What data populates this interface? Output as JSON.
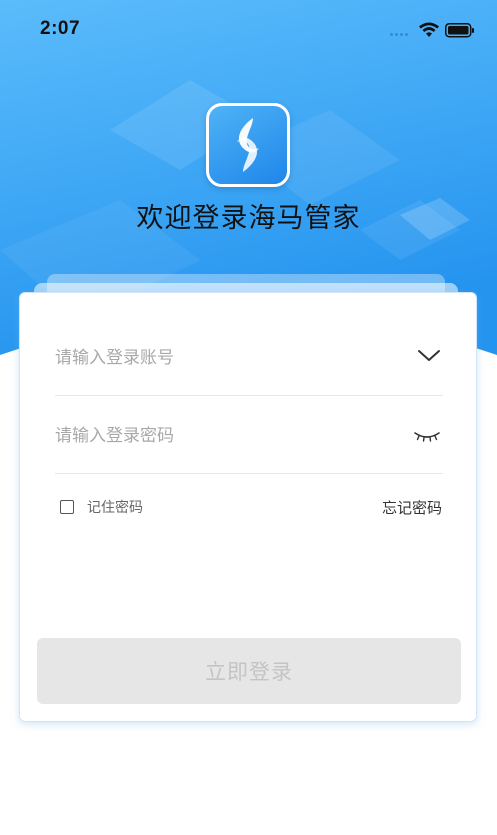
{
  "status_bar": {
    "time": "2:07"
  },
  "header": {
    "welcome_title": "欢迎登录海马管家"
  },
  "login_form": {
    "account_placeholder": "请输入登录账号",
    "password_placeholder": "请输入登录密码",
    "remember_label": "记住密码",
    "remember_checked": false,
    "forgot_label": "忘记密码",
    "submit_label": "立即登录"
  },
  "icons": [
    "wifi-icon",
    "battery-icon",
    "app-logo-icon",
    "chevron-down-icon",
    "eye-closed-icon",
    "checkbox-icon"
  ],
  "colors": {
    "hero_blue": "#2d9cf3",
    "hero_blue_light": "#6cc2fb",
    "button_disabled_bg": "#e6e6e6",
    "button_disabled_text": "#c4c4c4"
  }
}
